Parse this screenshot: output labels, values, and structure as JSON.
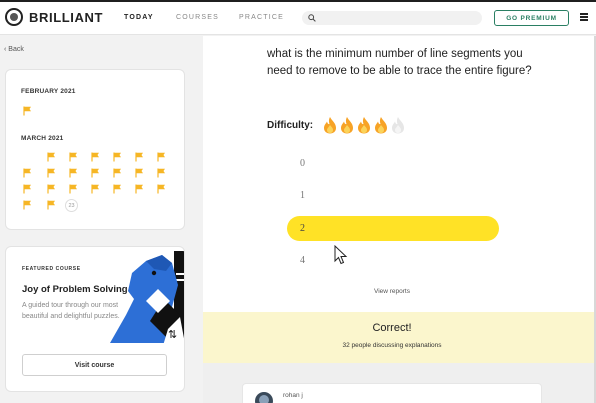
{
  "header": {
    "logo_text": "BRILLIANT",
    "nav": [
      {
        "label": "TODAY",
        "active": true
      },
      {
        "label": "COURSES",
        "active": false
      },
      {
        "label": "PRACTICE",
        "active": false
      }
    ],
    "search_placeholder": "",
    "premium_label": "GO PREMIUM"
  },
  "sidebar": {
    "back_label": "Back",
    "calendar": {
      "months": [
        {
          "label": "FEBRUARY 2021"
        },
        {
          "label": "MARCH 2021"
        }
      ],
      "today_day": "23"
    },
    "course": {
      "featured_label": "FEATURED COURSE",
      "title": "Joy of Problem Solving",
      "description": "A guided tour through our most beautiful and delightful puzzles.",
      "button_label": "Visit course"
    }
  },
  "main": {
    "question": "what is the minimum number of line segments you need to remove to be able to trace the entire figure?",
    "difficulty_label": "Difficulty:",
    "difficulty_level": 4,
    "difficulty_max": 5,
    "options": [
      {
        "label": "0",
        "selected": false
      },
      {
        "label": "1",
        "selected": false
      },
      {
        "label": "2",
        "selected": true
      },
      {
        "label": "4",
        "selected": false
      }
    ],
    "view_reports": "View reports"
  },
  "result": {
    "title": "Correct!",
    "subtitle": "32 people discussing explanations"
  },
  "discussion": {
    "commenter": "rohan j"
  },
  "colors": {
    "accent_yellow": "#ffe226",
    "flag_orange": "#f6b625",
    "premium_green": "#2a7f63",
    "result_bg": "#fbf6cd",
    "flame_orange": "#f7a326"
  }
}
